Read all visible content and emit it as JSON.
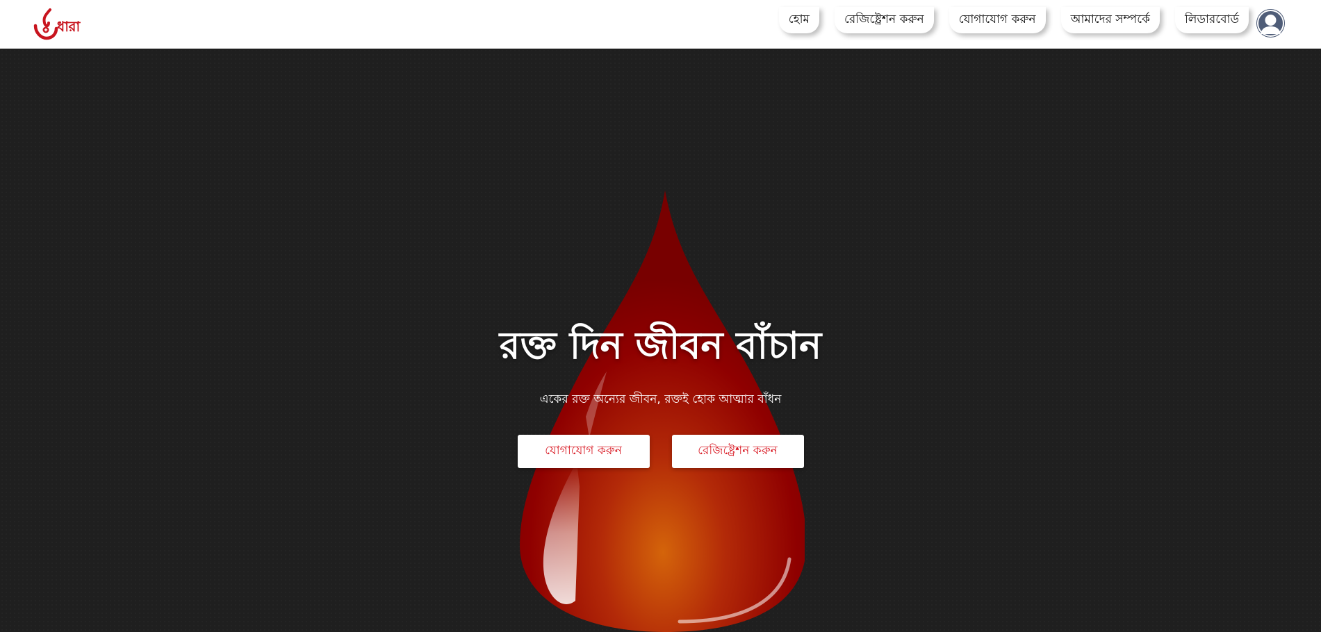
{
  "header": {
    "logo_text": "ধারা",
    "nav": [
      {
        "label": "হোম"
      },
      {
        "label": "রেজিষ্ট্রেশন করুন"
      },
      {
        "label": "যোগাযোগ করুন"
      },
      {
        "label": "আমাদের সম্পর্কে"
      },
      {
        "label": "লিডারবোর্ড"
      }
    ],
    "avatar_icon": "user-avatar-icon"
  },
  "hero": {
    "title": "রক্ত দিন জীবন বাঁচান",
    "subtitle": "একের রক্ত অন্যের জীবন, রক্তই হোক আত্মার বাঁধন",
    "buttons": {
      "contact": "যোগাযোগ করুন",
      "register": "রেজিষ্ট্রেশন করুন"
    }
  },
  "colors": {
    "brand_red": "#c8141e",
    "hero_background": "#1f1f1f",
    "drop_red": "#8f0000",
    "drop_orange": "#d4640a",
    "avatar_bg": "#4f5d78"
  }
}
